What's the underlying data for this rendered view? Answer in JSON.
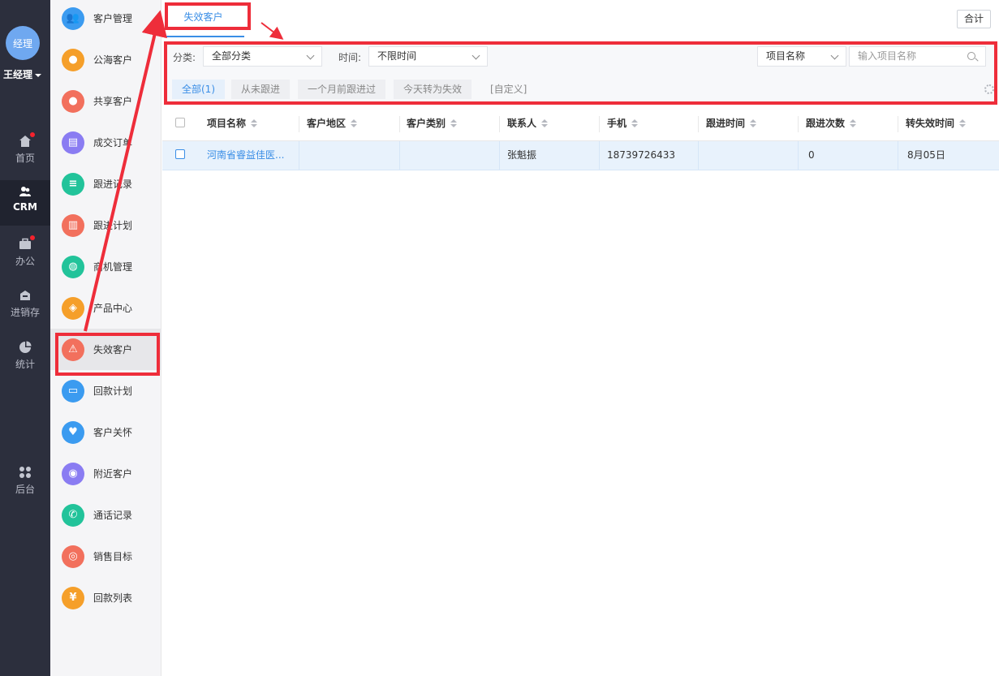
{
  "user": {
    "avatar_text": "经理",
    "name": "王经理"
  },
  "rail": [
    {
      "label": "首页",
      "icon": "home-icon",
      "badge": true
    },
    {
      "label": "CRM",
      "icon": "crm-icon",
      "badge": false,
      "active": true
    },
    {
      "label": "办公",
      "icon": "briefcase-icon",
      "badge": true
    },
    {
      "label": "进销存",
      "icon": "warehouse-icon",
      "badge": false
    },
    {
      "label": "统计",
      "icon": "pie-chart-icon",
      "badge": false
    },
    {
      "label": "后台",
      "icon": "grid-icon",
      "badge": false
    }
  ],
  "menu": [
    {
      "label": "客户管理",
      "color": "#3b9bf0",
      "icon": "customers-icon"
    },
    {
      "label": "公海客户",
      "color": "#f59f2a",
      "icon": "public-customer-icon"
    },
    {
      "label": "共享客户",
      "color": "#f2705d",
      "icon": "shared-customer-icon"
    },
    {
      "label": "成交订单",
      "color": "#8a7cf2",
      "icon": "order-icon"
    },
    {
      "label": "跟进记录",
      "color": "#22c39a",
      "icon": "record-icon"
    },
    {
      "label": "跟进计划",
      "color": "#f2705d",
      "icon": "plan-icon"
    },
    {
      "label": "商机管理",
      "color": "#22c39a",
      "icon": "opportunity-icon"
    },
    {
      "label": "产品中心",
      "color": "#f59f2a",
      "icon": "product-icon"
    },
    {
      "label": "失效客户",
      "color": "#f2705d",
      "icon": "warning-icon",
      "active": true
    },
    {
      "label": "回款计划",
      "color": "#3b9bf0",
      "icon": "payment-plan-icon"
    },
    {
      "label": "客户关怀",
      "color": "#3b9bf0",
      "icon": "care-icon"
    },
    {
      "label": "附近客户",
      "color": "#8a7cf2",
      "icon": "location-icon"
    },
    {
      "label": "通话记录",
      "color": "#22c39a",
      "icon": "phone-icon"
    },
    {
      "label": "销售目标",
      "color": "#f2705d",
      "icon": "target-icon"
    },
    {
      "label": "回款列表",
      "color": "#f59f2a",
      "icon": "payment-list-icon"
    }
  ],
  "tab": {
    "label": "失效客户"
  },
  "total_button": "合计",
  "filters": {
    "category_label": "分类:",
    "category_value": "全部分类",
    "time_label": "时间:",
    "time_value": "不限时间",
    "field_select": "项目名称",
    "search_placeholder": "输入项目名称",
    "chips": [
      "全部(1)",
      "从未跟进",
      "一个月前跟进过",
      "今天转为失效",
      "[自定义]"
    ]
  },
  "table": {
    "columns": [
      "项目名称",
      "客户地区",
      "客户类别",
      "联系人",
      "手机",
      "跟进时间",
      "跟进次数",
      "转失效时间"
    ],
    "rows": [
      {
        "project": "河南省睿益佳医...",
        "region": "",
        "category": "",
        "contact": "张魁振",
        "phone": "18739726433",
        "follow_time": "",
        "follow_count": "0",
        "expire_time": "8月05日"
      }
    ]
  },
  "colors": {
    "accent": "#3a8ee6",
    "annotation": "#ee2d3a",
    "rail_bg": "#2c2f3d"
  }
}
